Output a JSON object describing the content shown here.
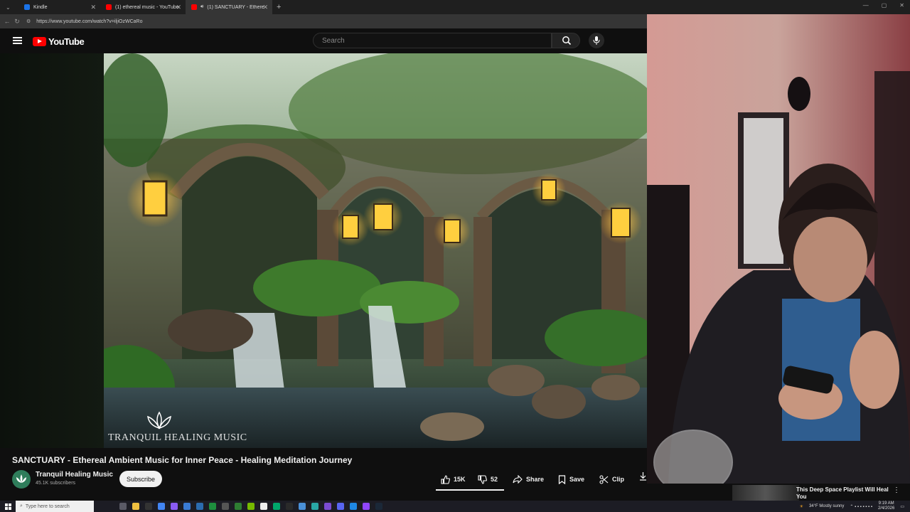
{
  "browser": {
    "tabs": [
      {
        "label": "Kindle",
        "active": false,
        "favicon_color": "#1a73e8"
      },
      {
        "label": "(1) ethereal music - YouTube",
        "active": false,
        "favicon_color": "#ff0000"
      },
      {
        "label": "(1) SANCTUARY - Ethereal Ar",
        "active": true,
        "favicon_color": "#ff0000"
      }
    ],
    "new_tab": "+",
    "url": "https://www.youtube.com/watch?v=iljiOzWCaRo"
  },
  "youtube": {
    "logo_text": "YouTube",
    "search_placeholder": "Search"
  },
  "video": {
    "watermark": "TRANQUIL HEALING MUSIC",
    "title": "SANCTUARY - Ethereal Ambient Music for Inner Peace - Healing Meditation Journey"
  },
  "channel": {
    "name": "Tranquil Healing Music",
    "subscribers": "45.1K subscribers",
    "subscribe_label": "Subscribe"
  },
  "actions": {
    "likes": "15K",
    "dislikes": "52",
    "share": "Share",
    "save": "Save",
    "clip": "Clip"
  },
  "recommendation": {
    "title": "This Deep Space Playlist Will Heal You"
  },
  "taskbar": {
    "search_placeholder": "Type here to search",
    "weather": "34°F  Mostly sunny",
    "time": "9:19 AM",
    "date": "2/4/2026"
  },
  "colors": {
    "youtube_red": "#ff0000",
    "background": "#0f0f0f",
    "webcam_wall": "#c9a39b"
  }
}
